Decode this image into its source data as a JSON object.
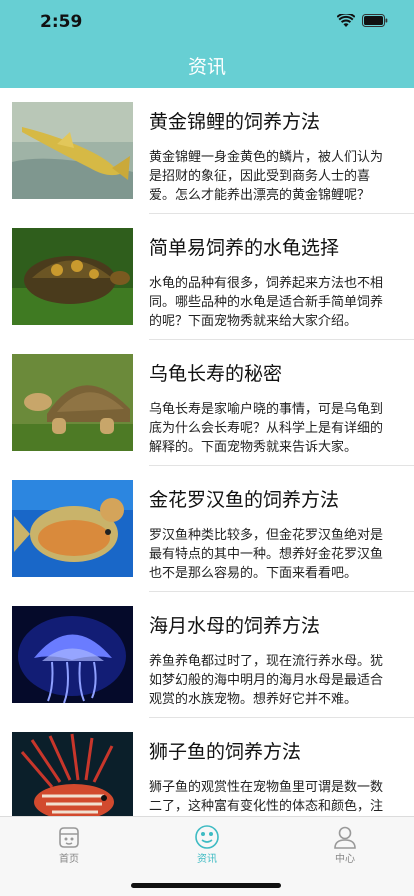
{
  "status": {
    "time": "2:59"
  },
  "header": {
    "title": "资讯"
  },
  "articles": [
    {
      "title": "黄金锦鲤的饲养方法",
      "desc": "黄金锦鲤一身金黄色的鳞片，被人们认为是招财的象征，因此受到商务人士的喜爱。怎么才能养出漂亮的黄金锦鲤呢？"
    },
    {
      "title": "简单易饲养的水龟选择",
      "desc": "水龟的品种有很多，饲养起来方法也不相同。哪些品种的水龟是适合新手简单饲养的呢？下面宠物秀就来给大家介绍。"
    },
    {
      "title": "乌龟长寿的秘密",
      "desc": "乌龟长寿是家喻户晓的事情，可是乌龟到底为什么会长寿呢？从科学上是有详细的解释的。下面宠物秀就来告诉大家。"
    },
    {
      "title": "金花罗汉鱼的饲养方法",
      "desc": "罗汉鱼种类比较多，但金花罗汉鱼绝对是最有特点的其中一种。想养好金花罗汉鱼也不是那么容易的。下面来看看吧。"
    },
    {
      "title": "海月水母的饲养方法",
      "desc": "养鱼养龟都过时了，现在流行养水母。犹如梦幻般的海中明月的海月水母是最适合观赏的水族宠物。想养好它并不难。"
    },
    {
      "title": "狮子鱼的饲养方法",
      "desc": "狮子鱼的观赏性在宠物鱼里可谓是数一数二了，这种富有变化性的体态和颜色，注定了狮子鱼的价值和美观。"
    }
  ],
  "tabs": [
    {
      "label": "首页",
      "icon": "home-icon"
    },
    {
      "label": "资讯",
      "icon": "news-icon"
    },
    {
      "label": "中心",
      "icon": "user-icon"
    }
  ],
  "colors": {
    "header": "#67cfd3",
    "active_tab": "#3ebbc3",
    "inactive_tab": "#888888"
  }
}
